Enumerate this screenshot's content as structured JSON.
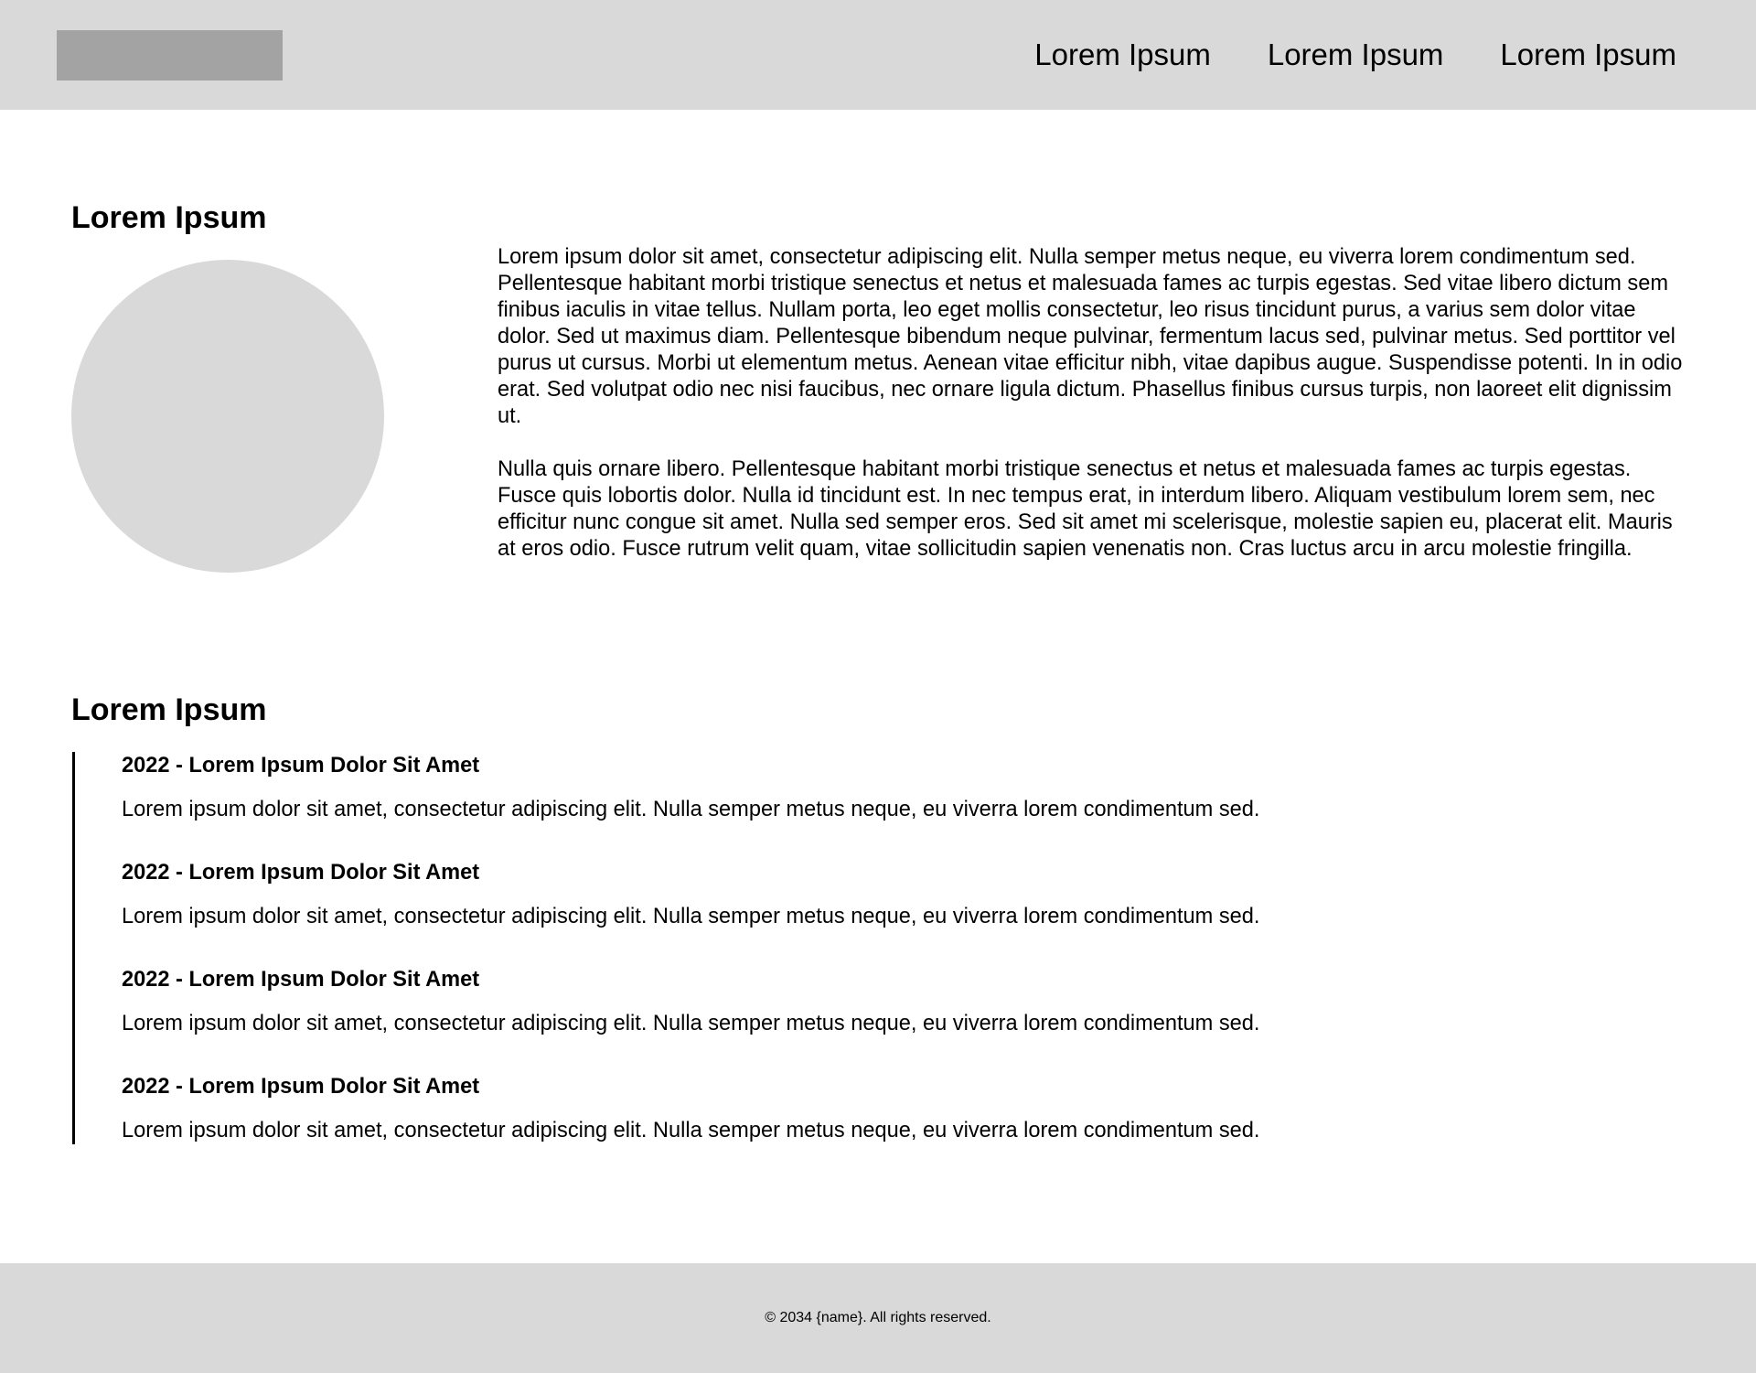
{
  "header": {
    "logo": "logo-placeholder",
    "nav": [
      {
        "label": "Lorem Ipsum"
      },
      {
        "label": "Lorem Ipsum"
      },
      {
        "label": "Lorem Ipsum"
      }
    ]
  },
  "about": {
    "title": "Lorem Ipsum",
    "avatar": "avatar-placeholder",
    "paragraphs": [
      "Lorem ipsum dolor sit amet, consectetur adipiscing elit. Nulla semper metus neque, eu viverra lorem condimentum sed. Pellentesque habitant morbi tristique senectus et netus et malesuada fames ac turpis egestas. Sed vitae libero dictum sem finibus iaculis in vitae tellus. Nullam porta, leo eget mollis consectetur, leo risus tincidunt purus, a varius sem dolor vitae dolor. Sed ut maximus diam. Pellentesque bibendum neque pulvinar, fermentum lacus sed, pulvinar metus. Sed porttitor vel purus ut cursus. Morbi ut elementum metus. Aenean vitae efficitur nibh, vitae dapibus augue. Suspendisse potenti. In in odio erat. Sed volutpat odio nec nisi faucibus, nec ornare ligula dictum. Phasellus finibus cursus turpis, non laoreet elit dignissim ut.",
      "Nulla quis ornare libero. Pellentesque habitant morbi tristique senectus et netus et malesuada fames ac turpis egestas. Fusce quis lobortis dolor. Nulla id tincidunt est. In nec tempus erat, in interdum libero. Aliquam vestibulum lorem sem, nec efficitur nunc congue sit amet. Nulla sed semper eros. Sed sit amet mi scelerisque, molestie sapien eu, placerat elit. Mauris at eros odio. Fusce rutrum velit quam, vitae sollicitudin sapien venenatis non. Cras luctus arcu in arcu molestie fringilla."
    ]
  },
  "timeline": {
    "title": "Lorem Ipsum",
    "entries": [
      {
        "title": "2022 - Lorem Ipsum Dolor Sit Amet",
        "description": "Lorem ipsum dolor sit amet, consectetur adipiscing elit. Nulla semper metus neque, eu viverra lorem condimentum sed."
      },
      {
        "title": "2022 - Lorem Ipsum Dolor Sit Amet",
        "description": "Lorem ipsum dolor sit amet, consectetur adipiscing elit. Nulla semper metus neque, eu viverra lorem condimentum sed."
      },
      {
        "title": "2022 - Lorem Ipsum Dolor Sit Amet",
        "description": "Lorem ipsum dolor sit amet, consectetur adipiscing elit. Nulla semper metus neque, eu viverra lorem condimentum sed."
      },
      {
        "title": "2022 - Lorem Ipsum Dolor Sit Amet",
        "description": "Lorem ipsum dolor sit amet, consectetur adipiscing elit. Nulla semper metus neque, eu viverra lorem condimentum sed."
      }
    ]
  },
  "footer": {
    "copyright": "© 2034 {name}. All rights reserved."
  },
  "colors": {
    "header_bg": "#d9d9d9",
    "logo_placeholder": "#a3a3a3",
    "avatar_placeholder": "#d9d9d9",
    "footer_bg": "#d9d9d9",
    "text": "#000000"
  }
}
